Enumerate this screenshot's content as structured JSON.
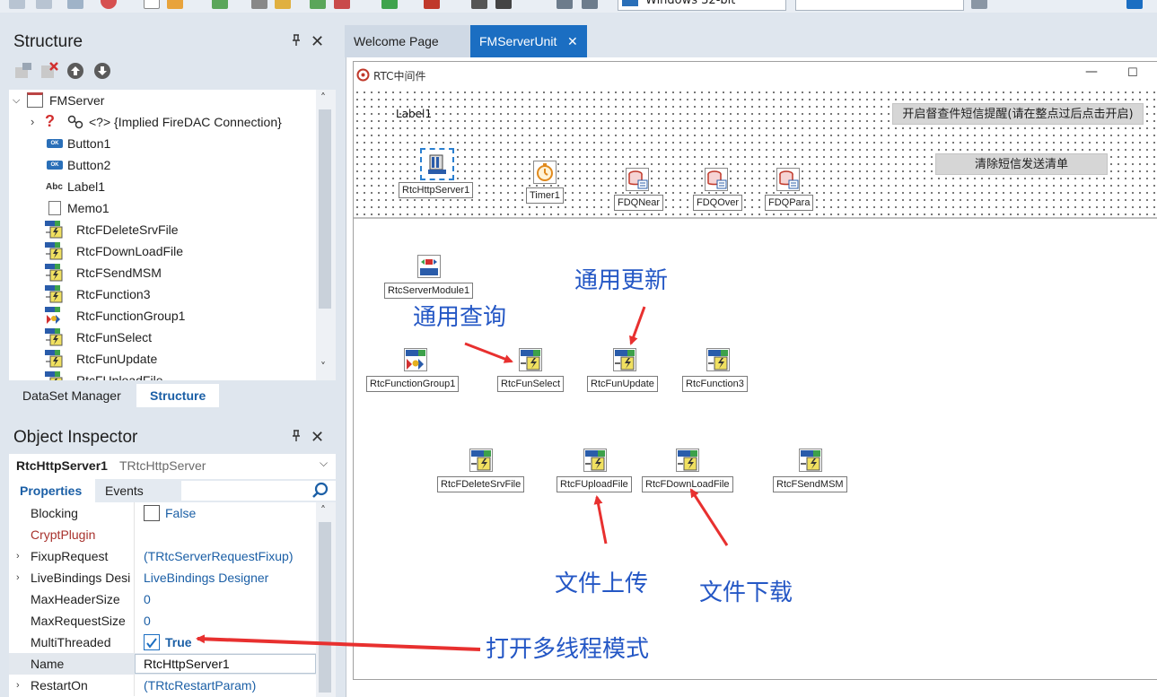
{
  "toolbar": {
    "platform_combo": "Windows 32-bit",
    "config_combo": ""
  },
  "structure_panel": {
    "title": "Structure",
    "pin": "ΐ",
    "close": "✕",
    "tree": {
      "root": "FMServer",
      "items": [
        {
          "label": "<?> {Implied FireDAC Connection}",
          "icon": "question-icon"
        },
        {
          "label": "Button1",
          "icon": "button-component-icon"
        },
        {
          "label": "Button2",
          "icon": "button-component-icon"
        },
        {
          "label": "Label1",
          "icon": "label-component-icon"
        },
        {
          "label": "Memo1",
          "icon": "memo-component-icon"
        },
        {
          "label": "RtcFDeleteSrvFile",
          "icon": "rtc-function-icon"
        },
        {
          "label": "RtcFDownLoadFile",
          "icon": "rtc-function-icon"
        },
        {
          "label": "RtcFSendMSM",
          "icon": "rtc-function-icon"
        },
        {
          "label": "RtcFunction3",
          "icon": "rtc-function-icon"
        },
        {
          "label": "RtcFunctionGroup1",
          "icon": "rtc-function-group-icon"
        },
        {
          "label": "RtcFunSelect",
          "icon": "rtc-function-icon"
        },
        {
          "label": "RtcFunUpdate",
          "icon": "rtc-function-icon"
        },
        {
          "label": "RtcFUploadFile",
          "icon": "rtc-function-icon"
        }
      ],
      "abc_text": "Abc",
      "ok_text": "OK"
    },
    "tabs": [
      "DataSet Manager",
      "Structure"
    ]
  },
  "object_inspector": {
    "title": "Object Inspector",
    "selected_name": "RtcHttpServer1",
    "selected_type": "TRtcHttpServer",
    "tabs": [
      "Properties",
      "Events"
    ],
    "properties": [
      {
        "name": "Blocking",
        "value": "False",
        "checkbox": false,
        "expandable": false
      },
      {
        "name": "CryptPlugin",
        "value": "",
        "expandable": false,
        "highlight": true
      },
      {
        "name": "FixupRequest",
        "value": "(TRtcServerRequestFixup)",
        "expandable": true
      },
      {
        "name": "LiveBindings Desi",
        "value": "LiveBindings Designer",
        "expandable": true
      },
      {
        "name": "MaxHeaderSize",
        "value": "0",
        "expandable": false
      },
      {
        "name": "MaxRequestSize",
        "value": "0",
        "expandable": false
      },
      {
        "name": "MultiThreaded",
        "value": "True",
        "checkbox": true,
        "expandable": false
      },
      {
        "name": "Name",
        "value": "RtcHttpServer1",
        "expandable": false,
        "selected": true
      },
      {
        "name": "RestartOn",
        "value": "(TRtcRestartParam)",
        "expandable": true
      }
    ]
  },
  "editor": {
    "tabs": [
      {
        "label": "Welcome Page",
        "active": false
      },
      {
        "label": "FMServerUnit",
        "active": true,
        "close": "✕"
      }
    ],
    "form": {
      "caption": "RTC中间件",
      "minimize": "—",
      "maximize": "☐",
      "label1": "Label1",
      "button1": "开启督查件短信提醒(请在整点过后点击开启)",
      "button2": "清除短信发送清单",
      "components_top": [
        "RtcHttpServer1",
        "Timer1",
        "FDQNear",
        "FDQOver",
        "FDQPara"
      ],
      "components": [
        "RtcServerModule1",
        "RtcFunctionGroup1",
        "RtcFunSelect",
        "RtcFunUpdate",
        "RtcFunction3",
        "RtcFDeleteSrvFile",
        "RtcFUploadFile",
        "RtcFDownLoadFile",
        "RtcFSendMSM"
      ]
    },
    "annotations": {
      "general_update": "通用更新",
      "general_query": "通用查询",
      "file_upload": "文件上传",
      "file_download": "文件下载",
      "multithread": "打开多线程模式"
    }
  },
  "colors": {
    "accent": "#1b6ec2",
    "arrow": "#e8302f",
    "annotation": "#2457c5",
    "tab_active": "#1b6ec2"
  }
}
